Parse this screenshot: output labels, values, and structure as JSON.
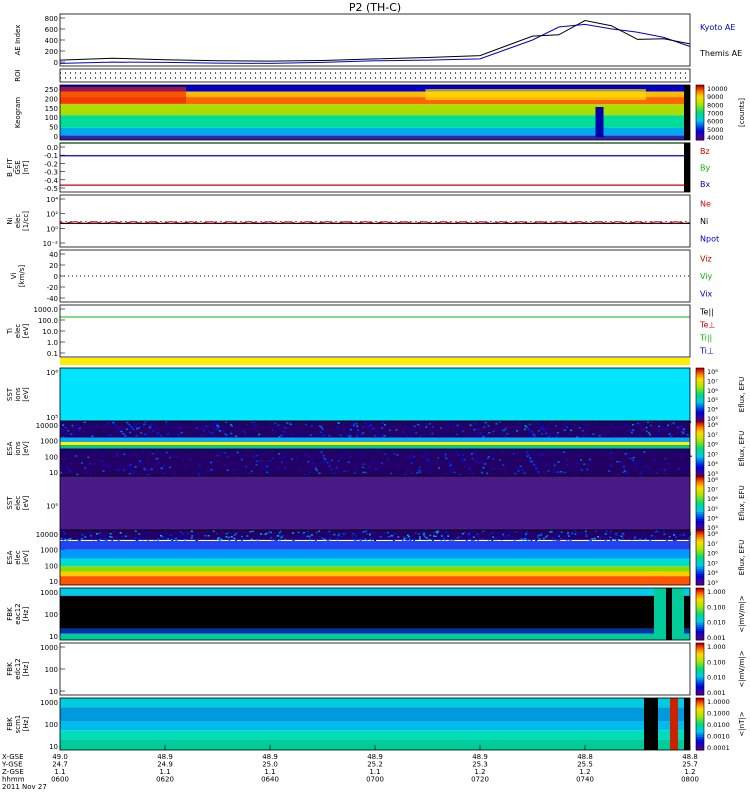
{
  "title": "P2 (TH-C)",
  "panels": [
    {
      "id": "ae",
      "ylabel": [
        "AE Index"
      ],
      "yticks": [
        "800",
        "600",
        "400",
        "200",
        "0"
      ],
      "right_labels": [
        {
          "text": "Kyoto AE",
          "color": "#0000cc"
        },
        {
          "text": "Themis AE",
          "color": "#000000"
        }
      ]
    },
    {
      "id": "roi",
      "ylabel": [
        "ROI"
      ],
      "yticks": [],
      "right_labels": []
    },
    {
      "id": "keogram",
      "ylabel": [
        "Keogram"
      ],
      "yticks": [
        "250",
        "200",
        "150",
        "100",
        "50",
        "0"
      ],
      "right_labels": []
    },
    {
      "id": "bfit",
      "ylabel": [
        "B_FIT",
        "GSE",
        "[nT]"
      ],
      "yticks": [
        "0.0",
        "-0.1",
        "-0.2",
        "-0.3",
        "-0.4",
        "-0.5"
      ],
      "right_labels": [
        {
          "text": "Bz",
          "color": "#cc0000"
        },
        {
          "text": "By",
          "color": "#00bb00"
        },
        {
          "text": "Bx",
          "color": "#0000cc"
        }
      ]
    },
    {
      "id": "ni",
      "ylabel": [
        "Ni",
        "elec",
        "[1/cc]"
      ],
      "yticks": [
        "10⁴",
        "10²",
        "10⁰",
        "10⁻²"
      ],
      "right_labels": [
        {
          "text": "Ne",
          "color": "#cc0000"
        },
        {
          "text": "Ni",
          "color": "#000000"
        },
        {
          "text": "Npot",
          "color": "#0000cc"
        }
      ]
    },
    {
      "id": "vi",
      "ylabel": [
        "Vi",
        "[km/s]"
      ],
      "yticks": [
        "40",
        "20",
        "0",
        "-20",
        "-40"
      ],
      "right_labels": [
        {
          "text": "Viz",
          "color": "#cc0000"
        },
        {
          "text": "Viy",
          "color": "#00bb00"
        },
        {
          "text": "Vix",
          "color": "#0000cc"
        }
      ]
    },
    {
      "id": "ti",
      "ylabel": [
        "Ti",
        "elec",
        "[eV]"
      ],
      "yticks": [
        "1000.0",
        "100.0",
        "10.0",
        "1.0",
        "0.1"
      ],
      "right_labels": [
        {
          "text": "Te||",
          "color": "#000000"
        },
        {
          "text": "Te⊥",
          "color": "#cc0000"
        },
        {
          "text": "Ti||",
          "color": "#00bb00"
        },
        {
          "text": "Ti⊥",
          "color": "#0000cc"
        }
      ]
    },
    {
      "id": "sst_i",
      "ylabel": [
        "SST",
        "ions",
        "[eV]"
      ],
      "yticks": [
        "10⁶",
        "10⁵"
      ],
      "right_labels": []
    },
    {
      "id": "esa_i",
      "ylabel": [
        "ESA",
        "ions",
        "[eV]"
      ],
      "yticks": [
        "10000",
        "1000",
        "100",
        "10"
      ],
      "right_labels": []
    },
    {
      "id": "sst_e",
      "ylabel": [
        "SST",
        "elec",
        "[eV]"
      ],
      "yticks": [
        "10⁵"
      ],
      "right_labels": []
    },
    {
      "id": "esa_e",
      "ylabel": [
        "ESA",
        "elec",
        "[eV]"
      ],
      "yticks": [
        "10000",
        "1000",
        "100",
        "10"
      ],
      "right_labels": []
    },
    {
      "id": "fbk1",
      "ylabel": [
        "FBK",
        "eac12",
        "[Hz]"
      ],
      "yticks": [
        "1000",
        "100",
        "10"
      ],
      "right_labels": []
    },
    {
      "id": "fbk2",
      "ylabel": [
        "FBK",
        "edc12",
        "[Hz]"
      ],
      "yticks": [
        "1000",
        "100",
        "10"
      ],
      "right_labels": []
    },
    {
      "id": "fbk3",
      "ylabel": [
        "FBK",
        "scm1",
        "[Hz]"
      ],
      "yticks": [
        "1000",
        "100",
        "10"
      ],
      "right_labels": []
    }
  ],
  "colorbars": [
    {
      "panel": "keogram",
      "ticks": [
        "10000",
        "9000",
        "8000",
        "7000",
        "6000",
        "5000",
        "4000"
      ],
      "label": "[counts]"
    },
    {
      "panel": "sst_i",
      "ticks": [
        "10⁸",
        "10⁷",
        "10⁶",
        "10⁵",
        "10⁴",
        "10³"
      ],
      "label": "Eflux, EFU"
    },
    {
      "panel": "esa_i",
      "ticks": [
        "10⁸",
        "10⁷",
        "10⁶",
        "10⁵",
        "10⁴",
        "10³"
      ],
      "label": "Eflux, EFU"
    },
    {
      "panel": "sst_e",
      "ticks": [
        "10⁸",
        "10⁷",
        "10⁶",
        "10⁵",
        "10⁴",
        "10³"
      ],
      "label": "Eflux, EFU"
    },
    {
      "panel": "esa_e",
      "ticks": [
        "10⁸",
        "10⁷",
        "10⁶",
        "10⁵",
        "10⁴",
        "10³"
      ],
      "label": "Eflux, EFU"
    },
    {
      "panel": "fbk1",
      "ticks": [
        "1.000",
        "0.100",
        "0.010",
        "0.001"
      ],
      "label": "<|mV/m|>"
    },
    {
      "panel": "fbk2",
      "ticks": [
        "1.000",
        "0.100",
        "0.010",
        "0.001"
      ],
      "label": "<|mV/m|>"
    },
    {
      "panel": "fbk3",
      "ticks": [
        "1.0000",
        "0.1000",
        "0.0100",
        "0.0010",
        "0.0001"
      ],
      "label": "<|nT|>"
    }
  ],
  "chart_data": {
    "type": "line",
    "title": "P2 (TH-C)",
    "x_range": [
      "0600",
      "0800"
    ],
    "ae_index": {
      "ylim": [
        0,
        800
      ],
      "time_min": [
        0,
        10,
        20,
        30,
        40,
        50,
        60,
        70,
        80,
        90,
        95,
        100,
        105,
        110,
        115,
        120
      ],
      "series": [
        {
          "name": "Kyoto AE",
          "color": "#0000cc",
          "values": [
            40,
            60,
            55,
            45,
            40,
            55,
            80,
            90,
            110,
            400,
            600,
            640,
            570,
            520,
            440,
            300
          ]
        },
        {
          "name": "Themis AE",
          "color": "#000000",
          "values": [
            90,
            120,
            95,
            80,
            75,
            85,
            110,
            130,
            160,
            460,
            480,
            700,
            620,
            410,
            420,
            340
          ]
        }
      ]
    },
    "b_fit": {
      "ylim": [
        -0.5,
        0.0
      ],
      "series": [
        {
          "name": "Bz",
          "color": "#cc0000",
          "value": -0.43
        },
        {
          "name": "By",
          "color": "#00bb00",
          "value": 0.0
        },
        {
          "name": "Bx",
          "color": "#0000cc",
          "value": -0.13
        }
      ]
    },
    "vi": {
      "ylim": [
        -50,
        50
      ],
      "zero_line": 0
    },
    "ti": {
      "ylim_log": [
        0.1,
        1000
      ],
      "series": [
        {
          "name": "Ti||",
          "color": "#00bb00",
          "value": 1000
        }
      ]
    },
    "x_axis": {
      "rows": [
        {
          "label": "X-GSE",
          "values": [
            "49.0",
            "48.9",
            "48.9",
            "48.9",
            "48.9",
            "48.8",
            "48.8"
          ]
        },
        {
          "label": "Y-GSE",
          "values": [
            "24.7",
            "24.9",
            "25.0",
            "25.2",
            "25.3",
            "25.5",
            "25.7"
          ]
        },
        {
          "label": "Z-GSE",
          "values": [
            "1.1",
            "1.1",
            "1.1",
            "1.1",
            "1.2",
            "1.2",
            "1.2"
          ]
        },
        {
          "label": "hhmm",
          "values": [
            "0600",
            "0620",
            "0640",
            "0700",
            "0720",
            "0740",
            "0800"
          ]
        }
      ],
      "date": "2011 Nov 27"
    }
  }
}
